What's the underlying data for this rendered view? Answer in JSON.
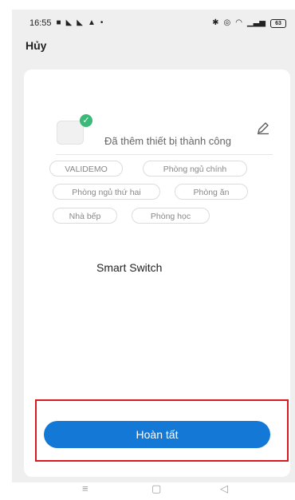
{
  "status_bar": {
    "time": "16:55",
    "left_icons": [
      "message-icon",
      "notification-icon",
      "notification-icon",
      "bell-icon",
      "dot-icon"
    ],
    "right_icons": [
      "bluetooth-icon",
      "alarm-icon",
      "wifi-icon",
      "signal-icon"
    ],
    "battery": "63"
  },
  "header": {
    "cancel_label": "Hủy"
  },
  "device": {
    "success_message": "Đã thêm thiết bị thành công",
    "name": "Smart Switch",
    "icon": "device-icon",
    "badge_icon": "check-icon",
    "edit_icon": "pencil-icon"
  },
  "rooms": [
    "VALIDEMO",
    "Phòng ngủ chính",
    "Phòng ngủ thứ hai",
    "Phòng ăn",
    "Nhà bếp",
    "Phòng học"
  ],
  "actions": {
    "done_label": "Hoàn tất"
  },
  "nav_bar": {
    "menu": "≡",
    "home": "▢",
    "back": "◁"
  },
  "colors": {
    "accent": "#1478d6",
    "success": "#3cb878",
    "highlight": "#d71920",
    "background": "#efefef"
  }
}
